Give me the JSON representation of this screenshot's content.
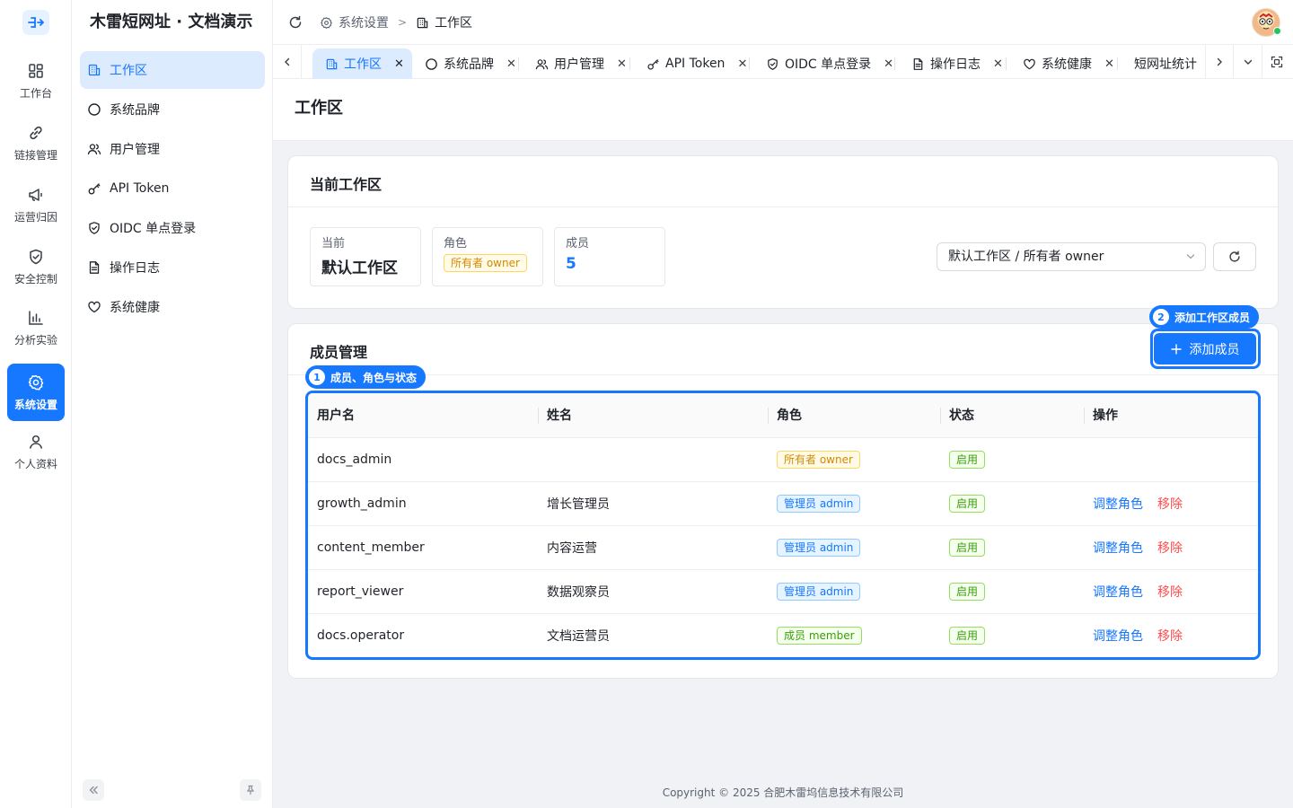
{
  "app": {
    "title": "木雷短网址 · 文档演示",
    "rail": [
      {
        "label": "工作台",
        "icon": "dashboard-icon"
      },
      {
        "label": "链接管理",
        "icon": "link-icon"
      },
      {
        "label": "运营归因",
        "icon": "megaphone-icon"
      },
      {
        "label": "安全控制",
        "icon": "shield-icon"
      },
      {
        "label": "分析实验",
        "icon": "bar-chart-icon"
      },
      {
        "label": "系统设置",
        "icon": "gear-icon",
        "active": true
      },
      {
        "label": "个人资料",
        "icon": "user-icon"
      }
    ],
    "menu": [
      {
        "label": "工作区",
        "icon": "building-icon",
        "active": true
      },
      {
        "label": "系统品牌",
        "icon": "circle-icon"
      },
      {
        "label": "用户管理",
        "icon": "users-icon"
      },
      {
        "label": "API Token",
        "icon": "key-icon"
      },
      {
        "label": "OIDC 单点登录",
        "icon": "shield-check-icon"
      },
      {
        "label": "操作日志",
        "icon": "document-icon"
      },
      {
        "label": "系统健康",
        "icon": "heart-icon"
      }
    ]
  },
  "header": {
    "breadcrumb": [
      "系统设置",
      "工作区"
    ]
  },
  "tabs": [
    {
      "label": "工作区",
      "active": true
    },
    {
      "label": "系统品牌"
    },
    {
      "label": "用户管理"
    },
    {
      "label": "API Token"
    },
    {
      "label": "OIDC 单点登录"
    },
    {
      "label": "操作日志"
    },
    {
      "label": "系统健康"
    },
    {
      "label": "短网址统计"
    }
  ],
  "page": {
    "title": "工作区"
  },
  "current": {
    "title": "当前工作区",
    "stats": {
      "current_label": "当前",
      "current_value": "默认工作区",
      "role_label": "角色",
      "role_value": "所有者 owner",
      "members_label": "成员",
      "members_value": "5"
    },
    "select_value": "默认工作区 / 所有者 owner"
  },
  "members": {
    "title": "成员管理",
    "add_label": "添加成员",
    "callout_table": "成员、角色与状态",
    "callout_add": "添加工作区成员",
    "columns": [
      "用户名",
      "姓名",
      "角色",
      "状态",
      "操作"
    ],
    "rows": [
      {
        "username": "docs_admin",
        "name": "",
        "role": "所有者 owner",
        "role_color": "gold",
        "status": "启用",
        "actions": []
      },
      {
        "username": "growth_admin",
        "name": "增长管理员",
        "role": "管理员 admin",
        "role_color": "blue",
        "status": "启用",
        "actions": [
          "调整角色",
          "移除"
        ]
      },
      {
        "username": "content_member",
        "name": "内容运营",
        "role": "管理员 admin",
        "role_color": "blue",
        "status": "启用",
        "actions": [
          "调整角色",
          "移除"
        ]
      },
      {
        "username": "report_viewer",
        "name": "数据观察员",
        "role": "管理员 admin",
        "role_color": "blue",
        "status": "启用",
        "actions": [
          "调整角色",
          "移除"
        ]
      },
      {
        "username": "docs.operator",
        "name": "文档运营员",
        "role": "成员 member",
        "role_color": "green",
        "status": "启用",
        "actions": [
          "调整角色",
          "移除"
        ]
      }
    ]
  },
  "footer": "Copyright © 2025 合肥木雷坞信息技术有限公司",
  "colors": {
    "primary": "#1677ff",
    "danger": "#ff4d4f",
    "owner_tag": "#d48806",
    "success": "#389e0d"
  }
}
